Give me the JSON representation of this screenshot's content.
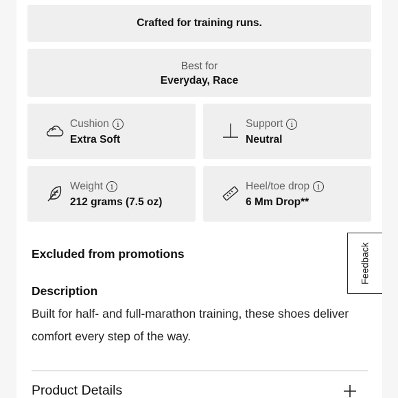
{
  "tagline": "Crafted for training runs.",
  "best_for": {
    "label": "Best for",
    "value": "Everyday, Race"
  },
  "specs": [
    {
      "icon": "cloud-icon",
      "label": "Cushion",
      "value": "Extra Soft"
    },
    {
      "icon": "support-icon",
      "label": "Support",
      "value": "Neutral"
    },
    {
      "icon": "feather-icon",
      "label": "Weight",
      "value": "212 grams (7.5 oz)"
    },
    {
      "icon": "ruler-icon",
      "label": "Heel/toe drop",
      "value": "6 Mm Drop**"
    }
  ],
  "info_glyph": "i",
  "excluded_text": "Excluded from promotions",
  "description": {
    "title": "Description",
    "body": "Built for half- and full-marathon training, these shoes deliver comfort every step of the way."
  },
  "product_details": {
    "label": "Product Details",
    "icon": "plus-icon"
  },
  "feedback_tab": "Feedback"
}
